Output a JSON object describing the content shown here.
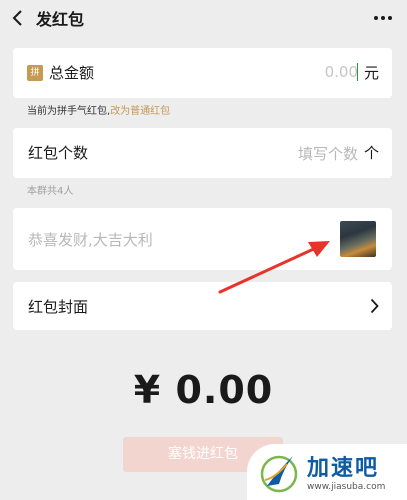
{
  "header": {
    "title": "发红包",
    "back_icon": "chevron-left-icon",
    "more_icon": "more-dots-icon"
  },
  "amount": {
    "badge": "拼",
    "label": "总金额",
    "value": "0.00",
    "unit": "元"
  },
  "hint": {
    "text": "当前为拼手气红包,",
    "link": "改为普通红包"
  },
  "count": {
    "label": "红包个数",
    "placeholder": "填写个数",
    "unit": "个"
  },
  "group_note": "本群共4人",
  "greeting": {
    "placeholder": "恭喜发财,大吉大利",
    "sticker_icon": "sticker-thumbnail"
  },
  "cover": {
    "label": "红包封面",
    "chevron_icon": "chevron-right-icon"
  },
  "total": {
    "display": "¥ 0.00"
  },
  "submit": {
    "label": "塞钱进红包"
  },
  "watermark": {
    "name": "加速吧",
    "url": "www.jiasuba.com"
  },
  "colors": {
    "background": "#ededed",
    "accent_gold": "#c49a55",
    "arrow_red": "#e8332a",
    "button_disabled": "#f3d5d0",
    "watermark_blue": "#0c5ba3"
  }
}
